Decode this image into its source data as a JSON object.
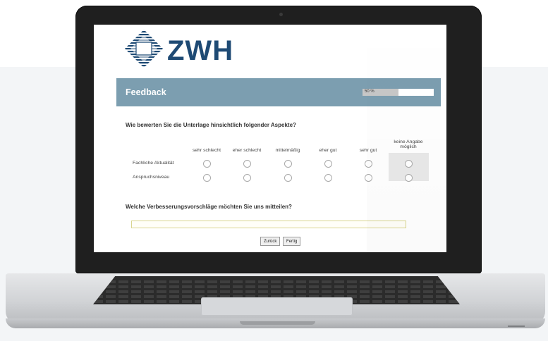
{
  "brand": {
    "name": "ZWH",
    "text_color": "#1e4a74"
  },
  "header": {
    "title": "Feedback",
    "bar_color": "#7c9eb0",
    "progress": {
      "label": "50 %",
      "percent": 50
    }
  },
  "question1": {
    "text": "Wie bewerten Sie die Unterlage hinsichtlich folgender Aspekte?",
    "columns": [
      "sehr schlecht",
      "eher schlecht",
      "mittelmäßig",
      "eher gut",
      "sehr gut",
      "keine Angabe möglich"
    ],
    "rows": [
      "Fachliche Aktualität",
      "Anspruchsniveau"
    ]
  },
  "question2": {
    "text": "Welche Verbesserungsvorschläge möchten Sie uns mitteilen?",
    "value": ""
  },
  "buttons": {
    "back": "Zurück",
    "finish": "Fertig"
  }
}
